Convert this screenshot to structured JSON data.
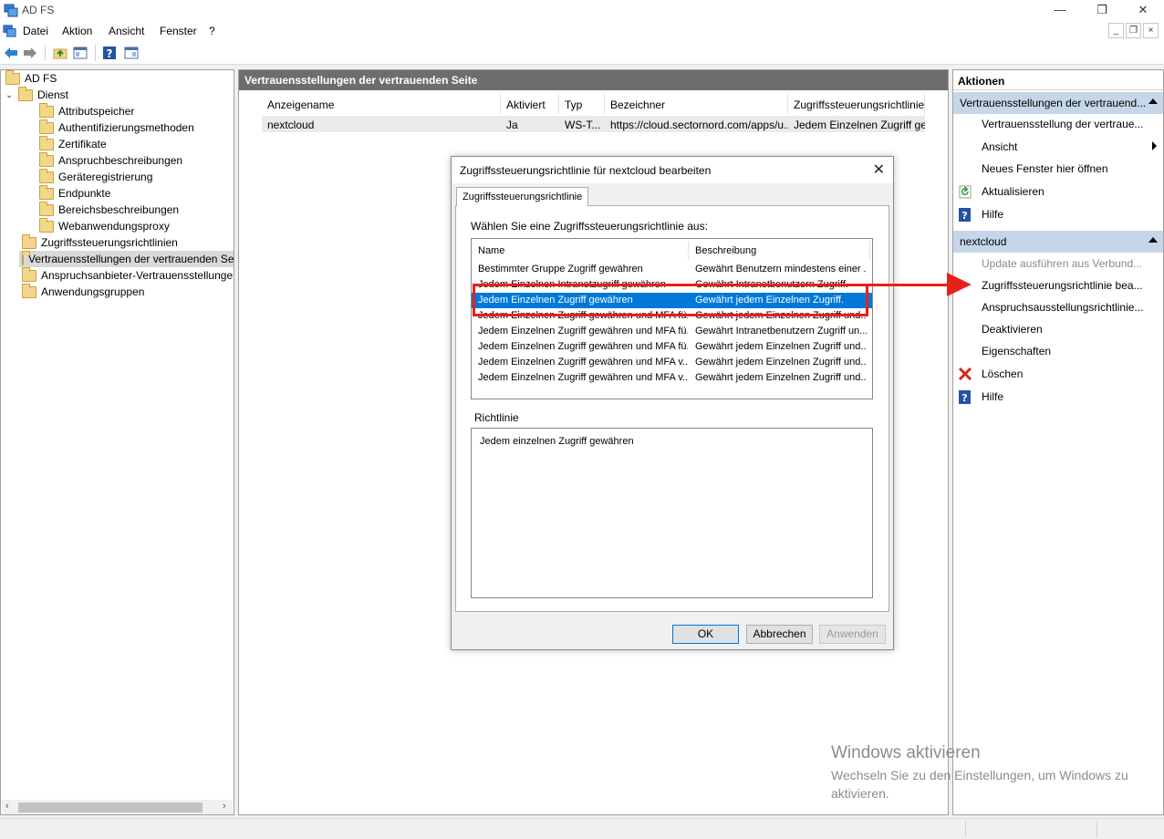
{
  "window": {
    "title": "AD FS",
    "buttons": {
      "minimize": "—",
      "maximize": "❐",
      "close": "✕"
    }
  },
  "menubar": {
    "items": [
      "Datei",
      "Aktion",
      "Ansicht",
      "Fenster",
      "?"
    ],
    "mdi": {
      "minimize": "_",
      "restore": "❐",
      "close": "×"
    }
  },
  "tree": {
    "items": [
      {
        "label": "AD FS"
      },
      {
        "label": "Dienst"
      },
      {
        "label": "Attributspeicher"
      },
      {
        "label": "Authentifizierungsmethoden"
      },
      {
        "label": "Zertifikate"
      },
      {
        "label": "Anspruchbeschreibungen"
      },
      {
        "label": "Geräteregistrierung"
      },
      {
        "label": "Endpunkte"
      },
      {
        "label": "Bereichsbeschreibungen"
      },
      {
        "label": "Webanwendungsproxy"
      },
      {
        "label": "Zugriffssteuerungsrichtlinien"
      },
      {
        "label": "Vertrauensstellungen der vertrauenden Seite"
      },
      {
        "label": "Anspruchsanbieter-Vertrauensstellungen"
      },
      {
        "label": "Anwendungsgruppen"
      }
    ]
  },
  "center": {
    "header": "Vertrauensstellungen der vertrauenden Seite",
    "columns": [
      "Anzeigename",
      "Aktiviert",
      "Typ",
      "Bezeichner",
      "Zugriffssteuerungsrichtlinie"
    ],
    "rows": [
      [
        "nextcloud",
        "Ja",
        "WS-T...",
        "https://cloud.sectornord.com/apps/u...",
        "Jedem Einzelnen Zugriff ge..."
      ]
    ]
  },
  "actions": {
    "title": "Aktionen",
    "section1": "Vertrauensstellungen der vertrauend...",
    "section1_items": [
      "Vertrauensstellung der vertraue...",
      "Ansicht",
      "Neues Fenster hier öffnen",
      "Aktualisieren",
      "Hilfe"
    ],
    "section2": "nextcloud",
    "section2_items": [
      "Update ausführen aus Verbund...",
      "Zugriffssteuerungsrichtlinie bea...",
      "Anspruchsausstellungsrichtlinie...",
      "Deaktivieren",
      "Eigenschaften",
      "Löschen",
      "Hilfe"
    ]
  },
  "dialog": {
    "title": "Zugriffssteuerungsrichtlinie für nextcloud bearbeiten",
    "close": "✕",
    "tab": "Zugriffssteuerungsrichtlinie",
    "choose_label": "Wählen Sie eine Zugriffssteuerungsrichtlinie aus:",
    "list_headers": [
      "Name",
      "Beschreibung"
    ],
    "policies": [
      {
        "name": "Bestimmter Gruppe Zugriff gewähren",
        "desc": "Gewährt Benutzern mindestens einer ..."
      },
      {
        "name": "Jedem Einzelnen Intranetzugriff gewähren",
        "desc": "Gewährt Intranetbenutzern Zugriff."
      },
      {
        "name": "Jedem Einzelnen Zugriff gewähren",
        "desc": "Gewährt jedem Einzelnen Zugriff."
      },
      {
        "name": "Jedem Einzelnen Zugriff gewähren und MFA fü...",
        "desc": "Gewährt jedem Einzelnen Zugriff und..."
      },
      {
        "name": "Jedem Einzelnen Zugriff gewähren und MFA fü...",
        "desc": "Gewährt Intranetbenutzern Zugriff un..."
      },
      {
        "name": "Jedem Einzelnen Zugriff gewähren und MFA fü...",
        "desc": "Gewährt jedem Einzelnen Zugriff und..."
      },
      {
        "name": "Jedem Einzelnen Zugriff gewähren und MFA v...",
        "desc": "Gewährt jedem Einzelnen Zugriff und..."
      },
      {
        "name": "Jedem Einzelnen Zugriff gewähren und MFA v...",
        "desc": "Gewährt jedem Einzelnen Zugriff und..."
      }
    ],
    "selected_index": 2,
    "policy_label": "Richtlinie",
    "policy_text": "Jedem einzelnen  Zugriff gewähren",
    "buttons": {
      "ok": "OK",
      "cancel": "Abbrechen",
      "apply": "Anwenden"
    }
  },
  "watermark": {
    "line1": "Windows aktivieren",
    "line2": "Wechseln Sie zu den Einstellungen, um Windows zu aktivieren."
  },
  "colors": {
    "selection": "#0078d7",
    "annotation": "#e8201a",
    "section_bg": "#c5d6e8",
    "header_bg": "#6d6d6d"
  }
}
